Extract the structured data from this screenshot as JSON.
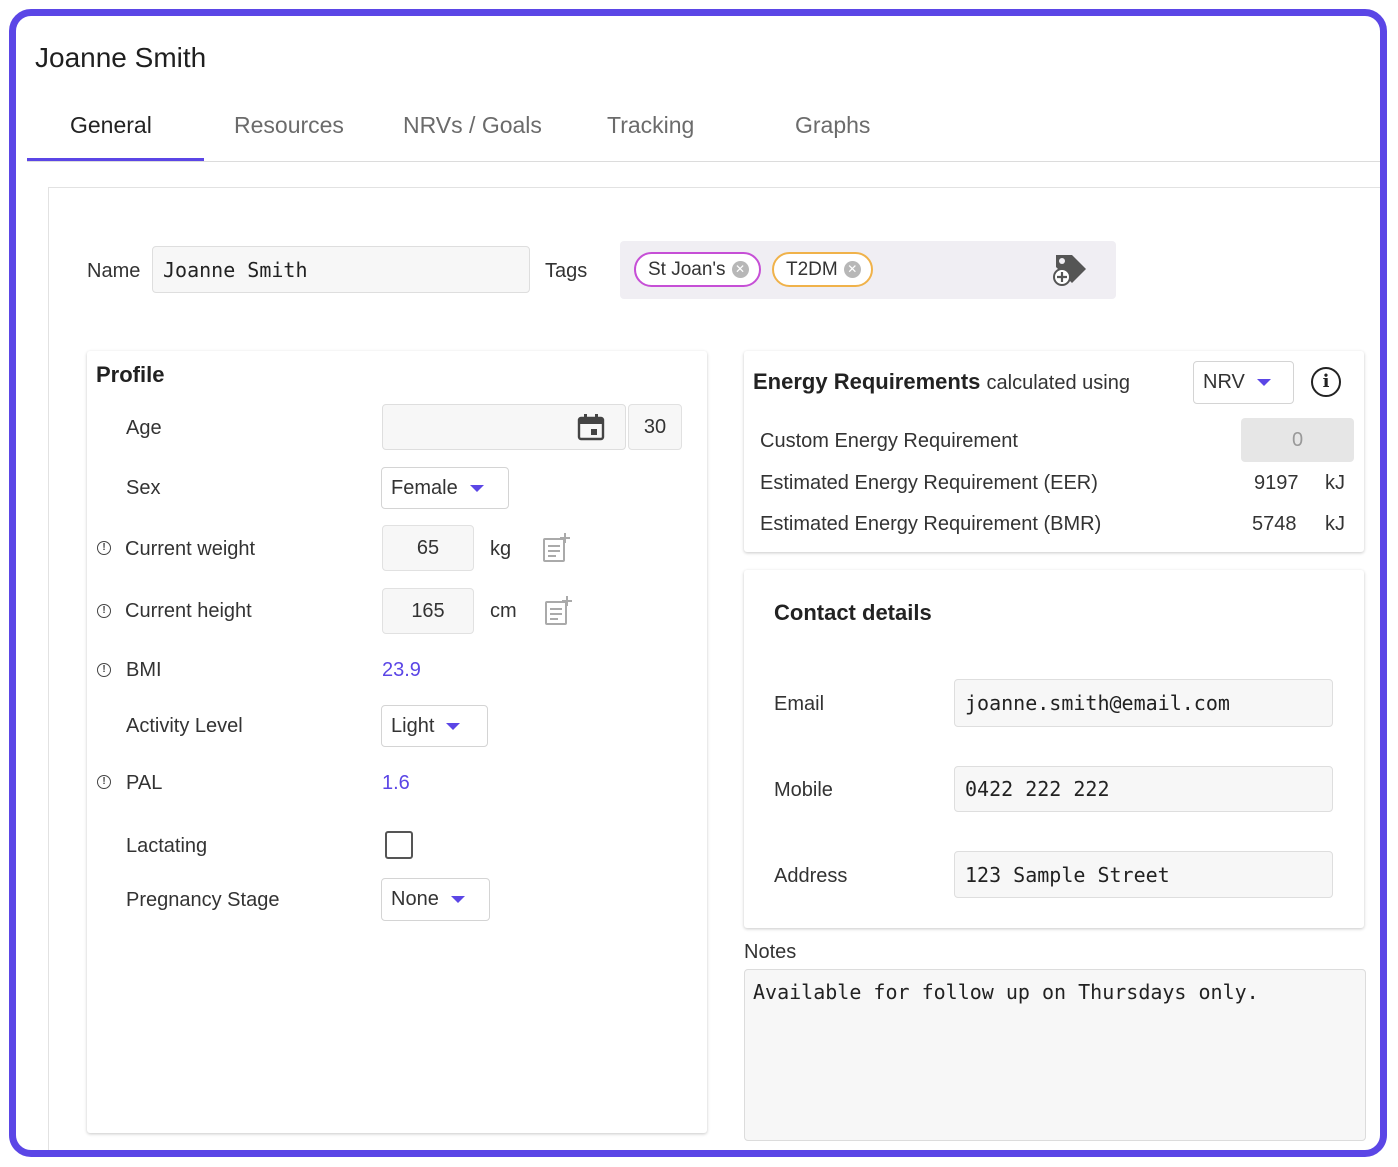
{
  "header": {
    "title": "Joanne Smith"
  },
  "tabs": [
    {
      "label": "General",
      "active": true
    },
    {
      "label": "Resources",
      "active": false
    },
    {
      "label": "NRVs / Goals",
      "active": false
    },
    {
      "label": "Tracking",
      "active": false
    },
    {
      "label": "Graphs",
      "active": false
    }
  ],
  "client": {
    "name_label": "Name",
    "name_value": "Joanne Smith",
    "tags_label": "Tags",
    "tags": [
      {
        "label": "St Joan's",
        "color": "#c64fd6"
      },
      {
        "label": "T2DM",
        "color": "#f0b24a"
      }
    ],
    "add_tag_icon": "tag-add-icon"
  },
  "profile": {
    "heading": "Profile",
    "age_label": "Age",
    "age_date_value": "",
    "age_value": "30",
    "sex_label": "Sex",
    "sex_value": "Female",
    "weight_label": "Current weight",
    "weight_value": "65",
    "weight_unit": "kg",
    "height_label": "Current height",
    "height_value": "165",
    "height_unit": "cm",
    "bmi_label": "BMI",
    "bmi_value": "23.9",
    "activity_label": "Activity Level",
    "activity_value": "Light",
    "pal_label": "PAL",
    "pal_value": "1.6",
    "lactating_label": "Lactating",
    "lactating_checked": false,
    "pregnancy_label": "Pregnancy Stage",
    "pregnancy_value": "None"
  },
  "energy": {
    "heading": "Energy Requirements",
    "subheading": "calculated using",
    "method_value": "NRV",
    "custom_label": "Custom Energy Requirement",
    "custom_value": "0",
    "eer_label": "Estimated Energy Requirement (EER)",
    "eer_value": "9197",
    "eer_unit": "kJ",
    "bmr_label": "Estimated Energy Requirement (BMR)",
    "bmr_value": "5748",
    "bmr_unit": "kJ"
  },
  "contact": {
    "heading": "Contact details",
    "email_label": "Email",
    "email_value": "joanne.smith@email.com",
    "mobile_label": "Mobile",
    "mobile_value": "0422 222 222",
    "address_label": "Address",
    "address_value": "123 Sample Street"
  },
  "notes": {
    "label": "Notes",
    "value": "Available for follow up on Thursdays only."
  },
  "colors": {
    "accent": "#5b46e6",
    "frame": "#5b46e6"
  }
}
